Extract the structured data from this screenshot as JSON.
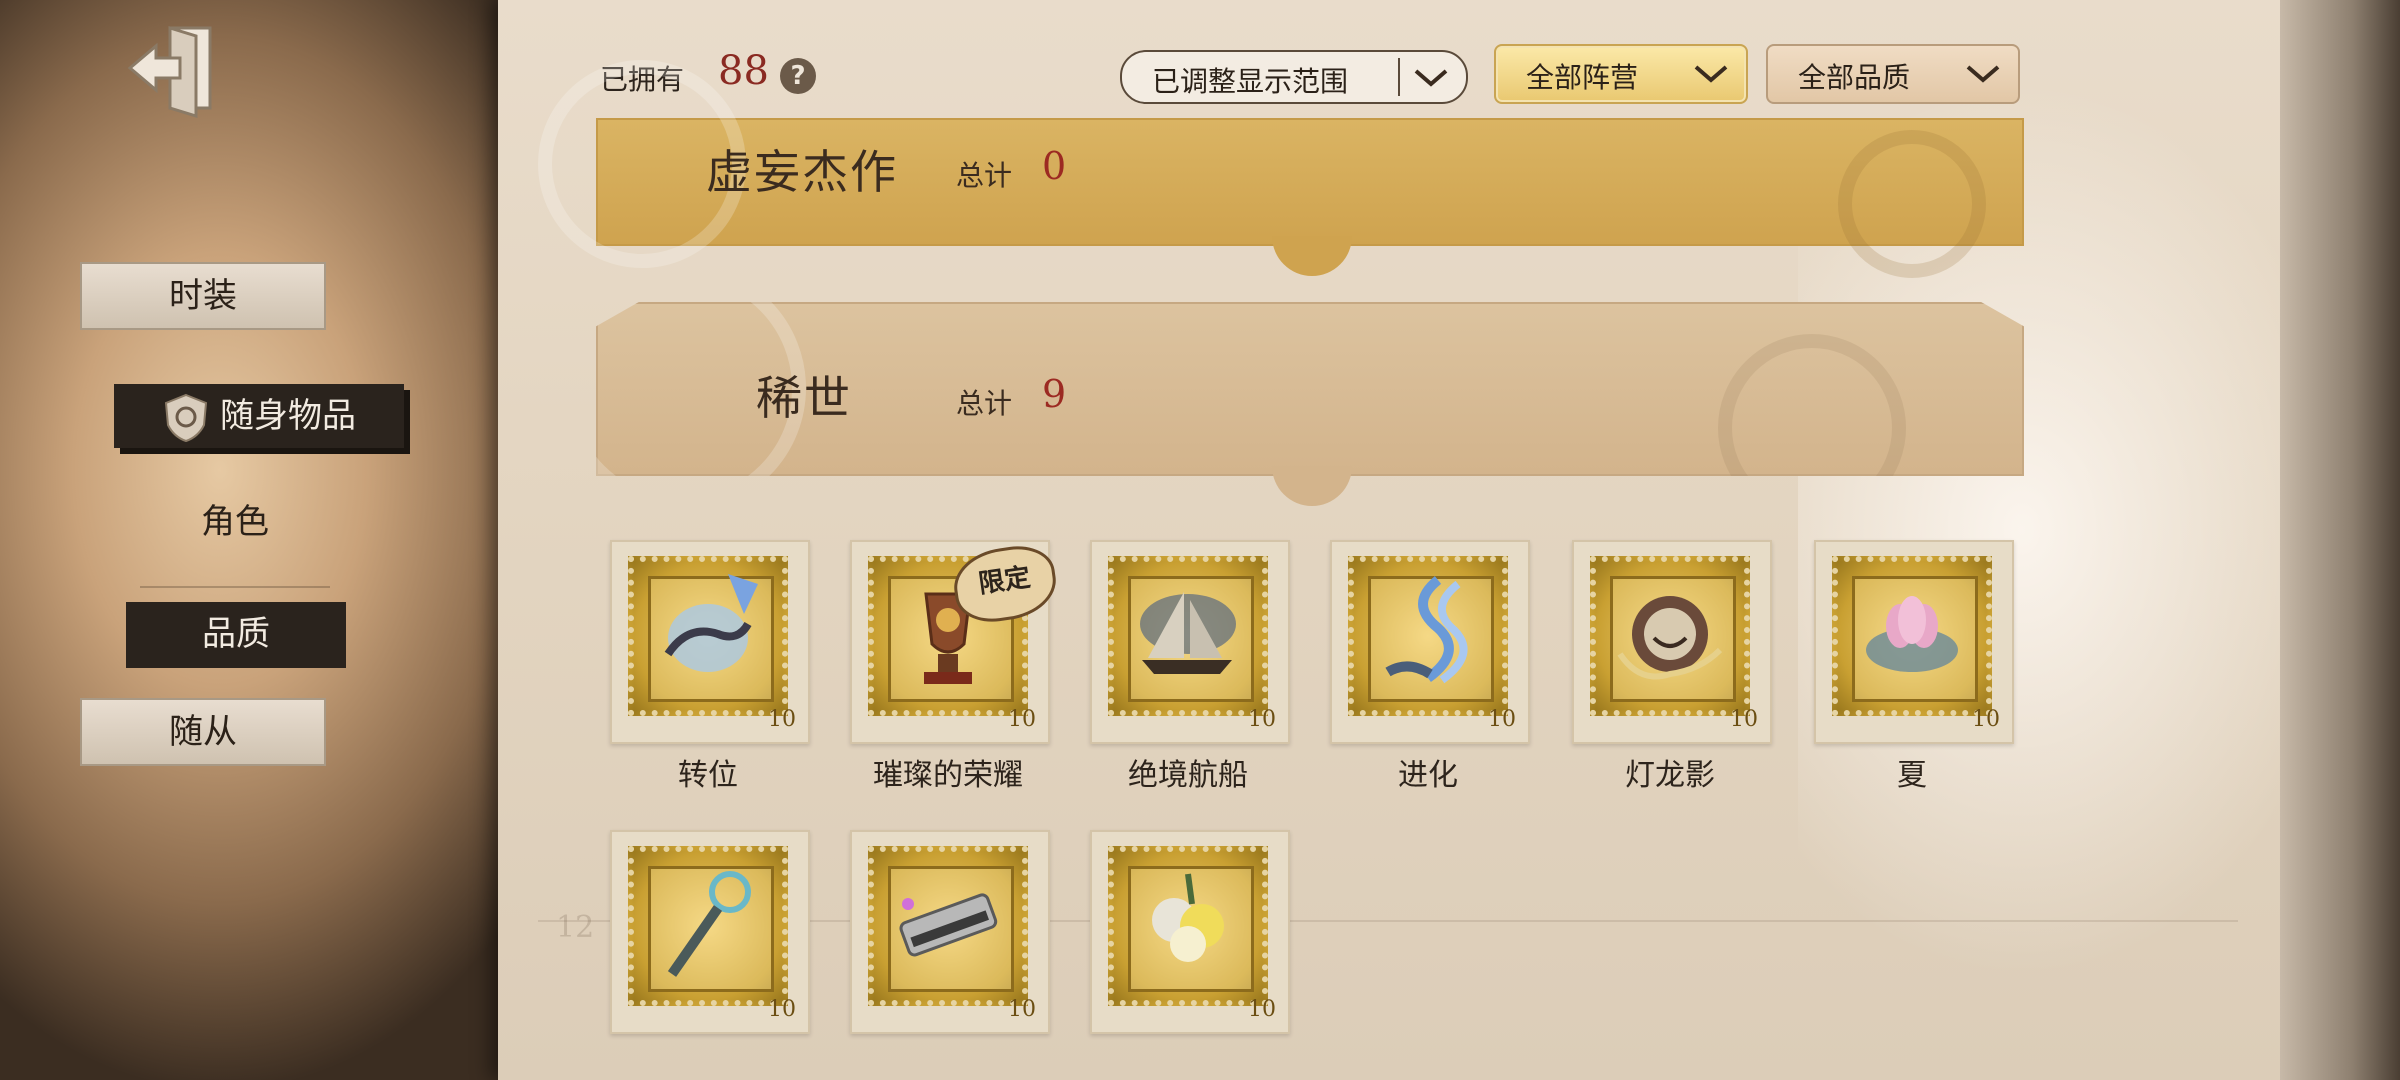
{
  "menu": {
    "items": [
      {
        "label": "时装"
      },
      {
        "label": "随身物品"
      },
      {
        "label": "角色"
      },
      {
        "label": "品质"
      },
      {
        "label": "随从"
      }
    ]
  },
  "header": {
    "owned_label": "已拥有",
    "owned_count": "88",
    "help_glyph": "?",
    "filters": [
      {
        "label": "已调整显示范围"
      },
      {
        "label": "全部阵营"
      },
      {
        "label": "全部品质"
      }
    ]
  },
  "sections": [
    {
      "title": "虚妄杰作",
      "total_label": "总计",
      "count": "0"
    },
    {
      "title": "稀世",
      "total_label": "总计",
      "count": "9"
    }
  ],
  "items": [
    {
      "name": "转位",
      "value": "10",
      "icon": "gauntlet-icon",
      "limited": ""
    },
    {
      "name": "璀璨的荣耀",
      "value": "10",
      "icon": "trophy-icon",
      "limited": "限定"
    },
    {
      "name": "绝境航船",
      "value": "10",
      "icon": "ship-icon",
      "limited": ""
    },
    {
      "name": "进化",
      "value": "10",
      "icon": "dna-icon",
      "limited": ""
    },
    {
      "name": "灯龙影",
      "value": "10",
      "icon": "dragon-lantern-icon",
      "limited": ""
    },
    {
      "name": "夏",
      "value": "10",
      "icon": "lotus-icon",
      "limited": ""
    },
    {
      "name": "",
      "value": "10",
      "icon": "staff-icon",
      "limited": ""
    },
    {
      "name": "",
      "value": "10",
      "icon": "harmonica-icon",
      "limited": ""
    },
    {
      "name": "",
      "value": "10",
      "icon": "flower-bouquet-icon",
      "limited": ""
    }
  ],
  "colors": {
    "accent_red": "#9c2a22",
    "gold": "#d4aa50",
    "dark_menu": "#2a231d"
  }
}
